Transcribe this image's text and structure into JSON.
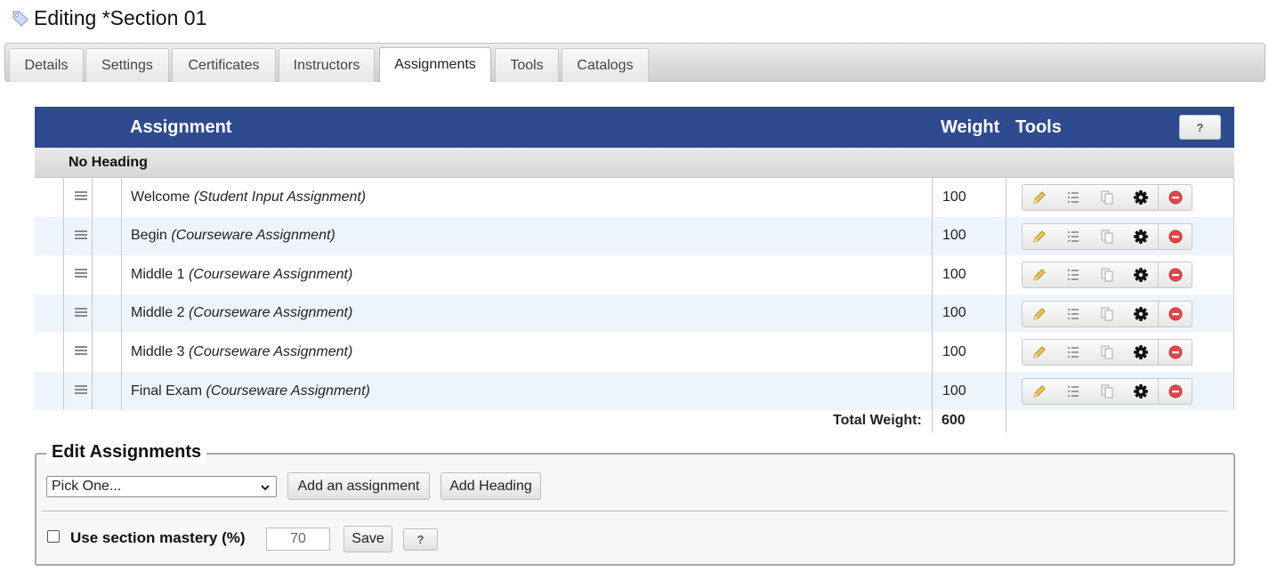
{
  "page": {
    "title": "Editing *Section 01"
  },
  "tabs": [
    {
      "label": "Details"
    },
    {
      "label": "Settings"
    },
    {
      "label": "Certificates"
    },
    {
      "label": "Instructors"
    },
    {
      "label": "Assignments",
      "active": true
    },
    {
      "label": "Tools"
    },
    {
      "label": "Catalogs"
    }
  ],
  "table": {
    "col_assignment": "Assignment",
    "col_weight": "Weight",
    "col_tools": "Tools",
    "help_label": "?",
    "group_heading": "No Heading",
    "rows": [
      {
        "name": "Welcome",
        "type": "(Student Input Assignment)",
        "weight": "100"
      },
      {
        "name": "Begin",
        "type": "(Courseware Assignment)",
        "weight": "100"
      },
      {
        "name": "Middle 1",
        "type": "(Courseware Assignment)",
        "weight": "100"
      },
      {
        "name": "Middle 2",
        "type": "(Courseware Assignment)",
        "weight": "100"
      },
      {
        "name": "Middle 3",
        "type": "(Courseware Assignment)",
        "weight": "100"
      },
      {
        "name": "Final Exam",
        "type": "(Courseware Assignment)",
        "weight": "100"
      }
    ],
    "row_tools": [
      "pencil-icon",
      "list-icon",
      "copy-icon",
      "gear-icon",
      "remove-icon"
    ],
    "total_label": "Total Weight:",
    "total_value": "600"
  },
  "edit": {
    "legend": "Edit Assignments",
    "select_value": "Pick One...",
    "add_assignment_label": "Add an assignment",
    "add_heading_label": "Add Heading",
    "mastery_label": "Use section mastery (%)",
    "mastery_checked": false,
    "mastery_value": "70",
    "save_label": "Save",
    "help_label": "?"
  },
  "colors": {
    "header_bg": "#2f4a8f",
    "row_alt_bg": "#eef4fc",
    "remove_red": "#e04848",
    "pencil_yellow": "#e8b73a"
  }
}
